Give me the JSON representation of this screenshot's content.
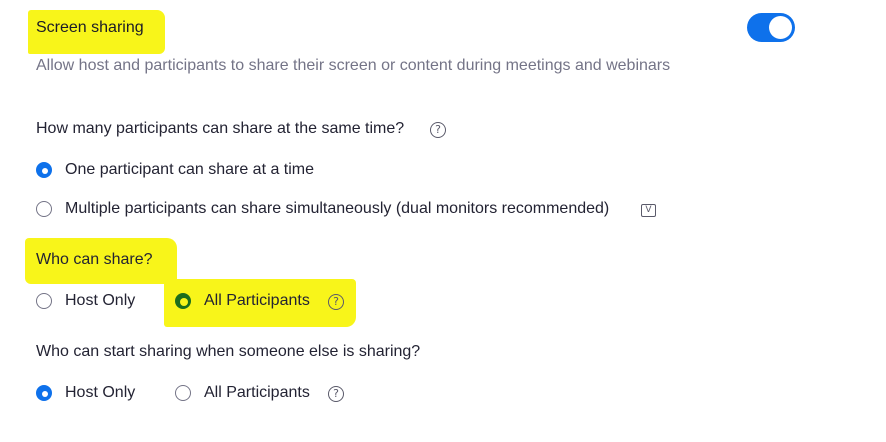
{
  "screen_sharing": {
    "title": "Screen sharing",
    "description": "Allow host and participants to share their screen or content during meetings and webinars",
    "enabled": true
  },
  "how_many": {
    "question": "How many participants can share at the same time?",
    "options": [
      {
        "label": "One participant can share at a time",
        "selected": true
      },
      {
        "label": "Multiple participants can share simultaneously (dual monitors recommended)",
        "selected": false
      }
    ]
  },
  "who_can_share": {
    "question": "Who can share?",
    "options": [
      {
        "label": "Host Only",
        "selected": false
      },
      {
        "label": "All Participants",
        "selected": true
      }
    ]
  },
  "who_can_start": {
    "question": "Who can start sharing when someone else is sharing?",
    "options": [
      {
        "label": "Host Only",
        "selected": true
      },
      {
        "label": "All Participants",
        "selected": false
      }
    ]
  },
  "icons": {
    "help": "?",
    "v_badge": "V"
  },
  "colors": {
    "accent": "#0e71eb",
    "highlight": "#f8f51a"
  }
}
